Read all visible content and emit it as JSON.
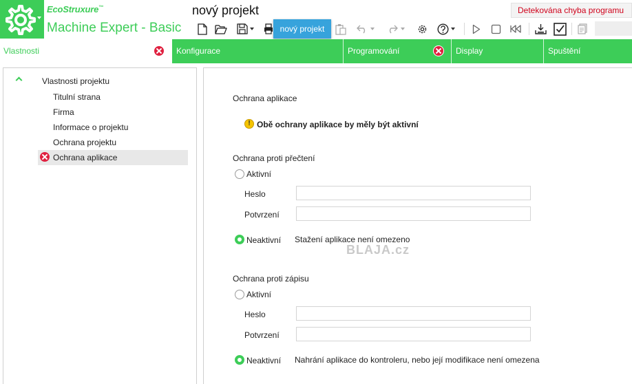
{
  "header": {
    "brand": "EcoStruxure",
    "brand_mark": "™",
    "product": "Machine Expert - Basic",
    "project_title": "nový projekt",
    "error_status": "Detekována chyba programu",
    "tooltip": "nový projekt"
  },
  "colors": {
    "accent": "#3dcd58",
    "error": "#e0203f",
    "tooltip": "#37a3dc",
    "warning": "#f5c400"
  },
  "toolbar": {
    "icons": [
      "new-file-icon",
      "open-folder-icon",
      "save-icon",
      "print-icon",
      "paste-icon",
      "undo-icon",
      "redo-icon",
      "settings-icon",
      "help-icon",
      "play-icon",
      "stop-icon",
      "rewind-icon",
      "download-icon",
      "checkbox-icon",
      "report-icon"
    ]
  },
  "tabs": [
    {
      "label": "Vlastnosti",
      "active": true,
      "error": true
    },
    {
      "label": "Konfigurace",
      "active": false,
      "error": false
    },
    {
      "label": "Programování",
      "active": false,
      "error": true
    },
    {
      "label": "Display",
      "active": false,
      "error": false
    },
    {
      "label": "Spuštění",
      "active": false,
      "error": false
    }
  ],
  "tree": {
    "root": "Vlastnosti projektu",
    "items": [
      {
        "label": "Titulní strana",
        "selected": false,
        "error": false
      },
      {
        "label": "Firma",
        "selected": false,
        "error": false
      },
      {
        "label": "Informace o projektu",
        "selected": false,
        "error": false
      },
      {
        "label": "Ochrana projektu",
        "selected": false,
        "error": false
      },
      {
        "label": "Ochrana aplikace",
        "selected": true,
        "error": true
      }
    ]
  },
  "content": {
    "title": "Ochrana aplikace",
    "warning": "Obě ochrany aplikace by měly být aktivní",
    "read_protection": {
      "title": "Ochrana proti přečtení",
      "active_label": "Aktivní",
      "password_label": "Heslo",
      "password_value": "",
      "confirm_label": "Potvrzení",
      "confirm_value": "",
      "inactive_label": "Neaktivní",
      "selected": "inactive",
      "description": "Stažení aplikace není omezeno"
    },
    "write_protection": {
      "title": "Ochrana proti zápisu",
      "active_label": "Aktivní",
      "password_label": "Heslo",
      "password_value": "",
      "confirm_label": "Potvrzení",
      "confirm_value": "",
      "inactive_label": "Neaktivní",
      "selected": "inactive",
      "description": "Nahrání aplikace do kontroleru, nebo její modifikace není omezena"
    },
    "watermark": "BLAJA.cz"
  }
}
